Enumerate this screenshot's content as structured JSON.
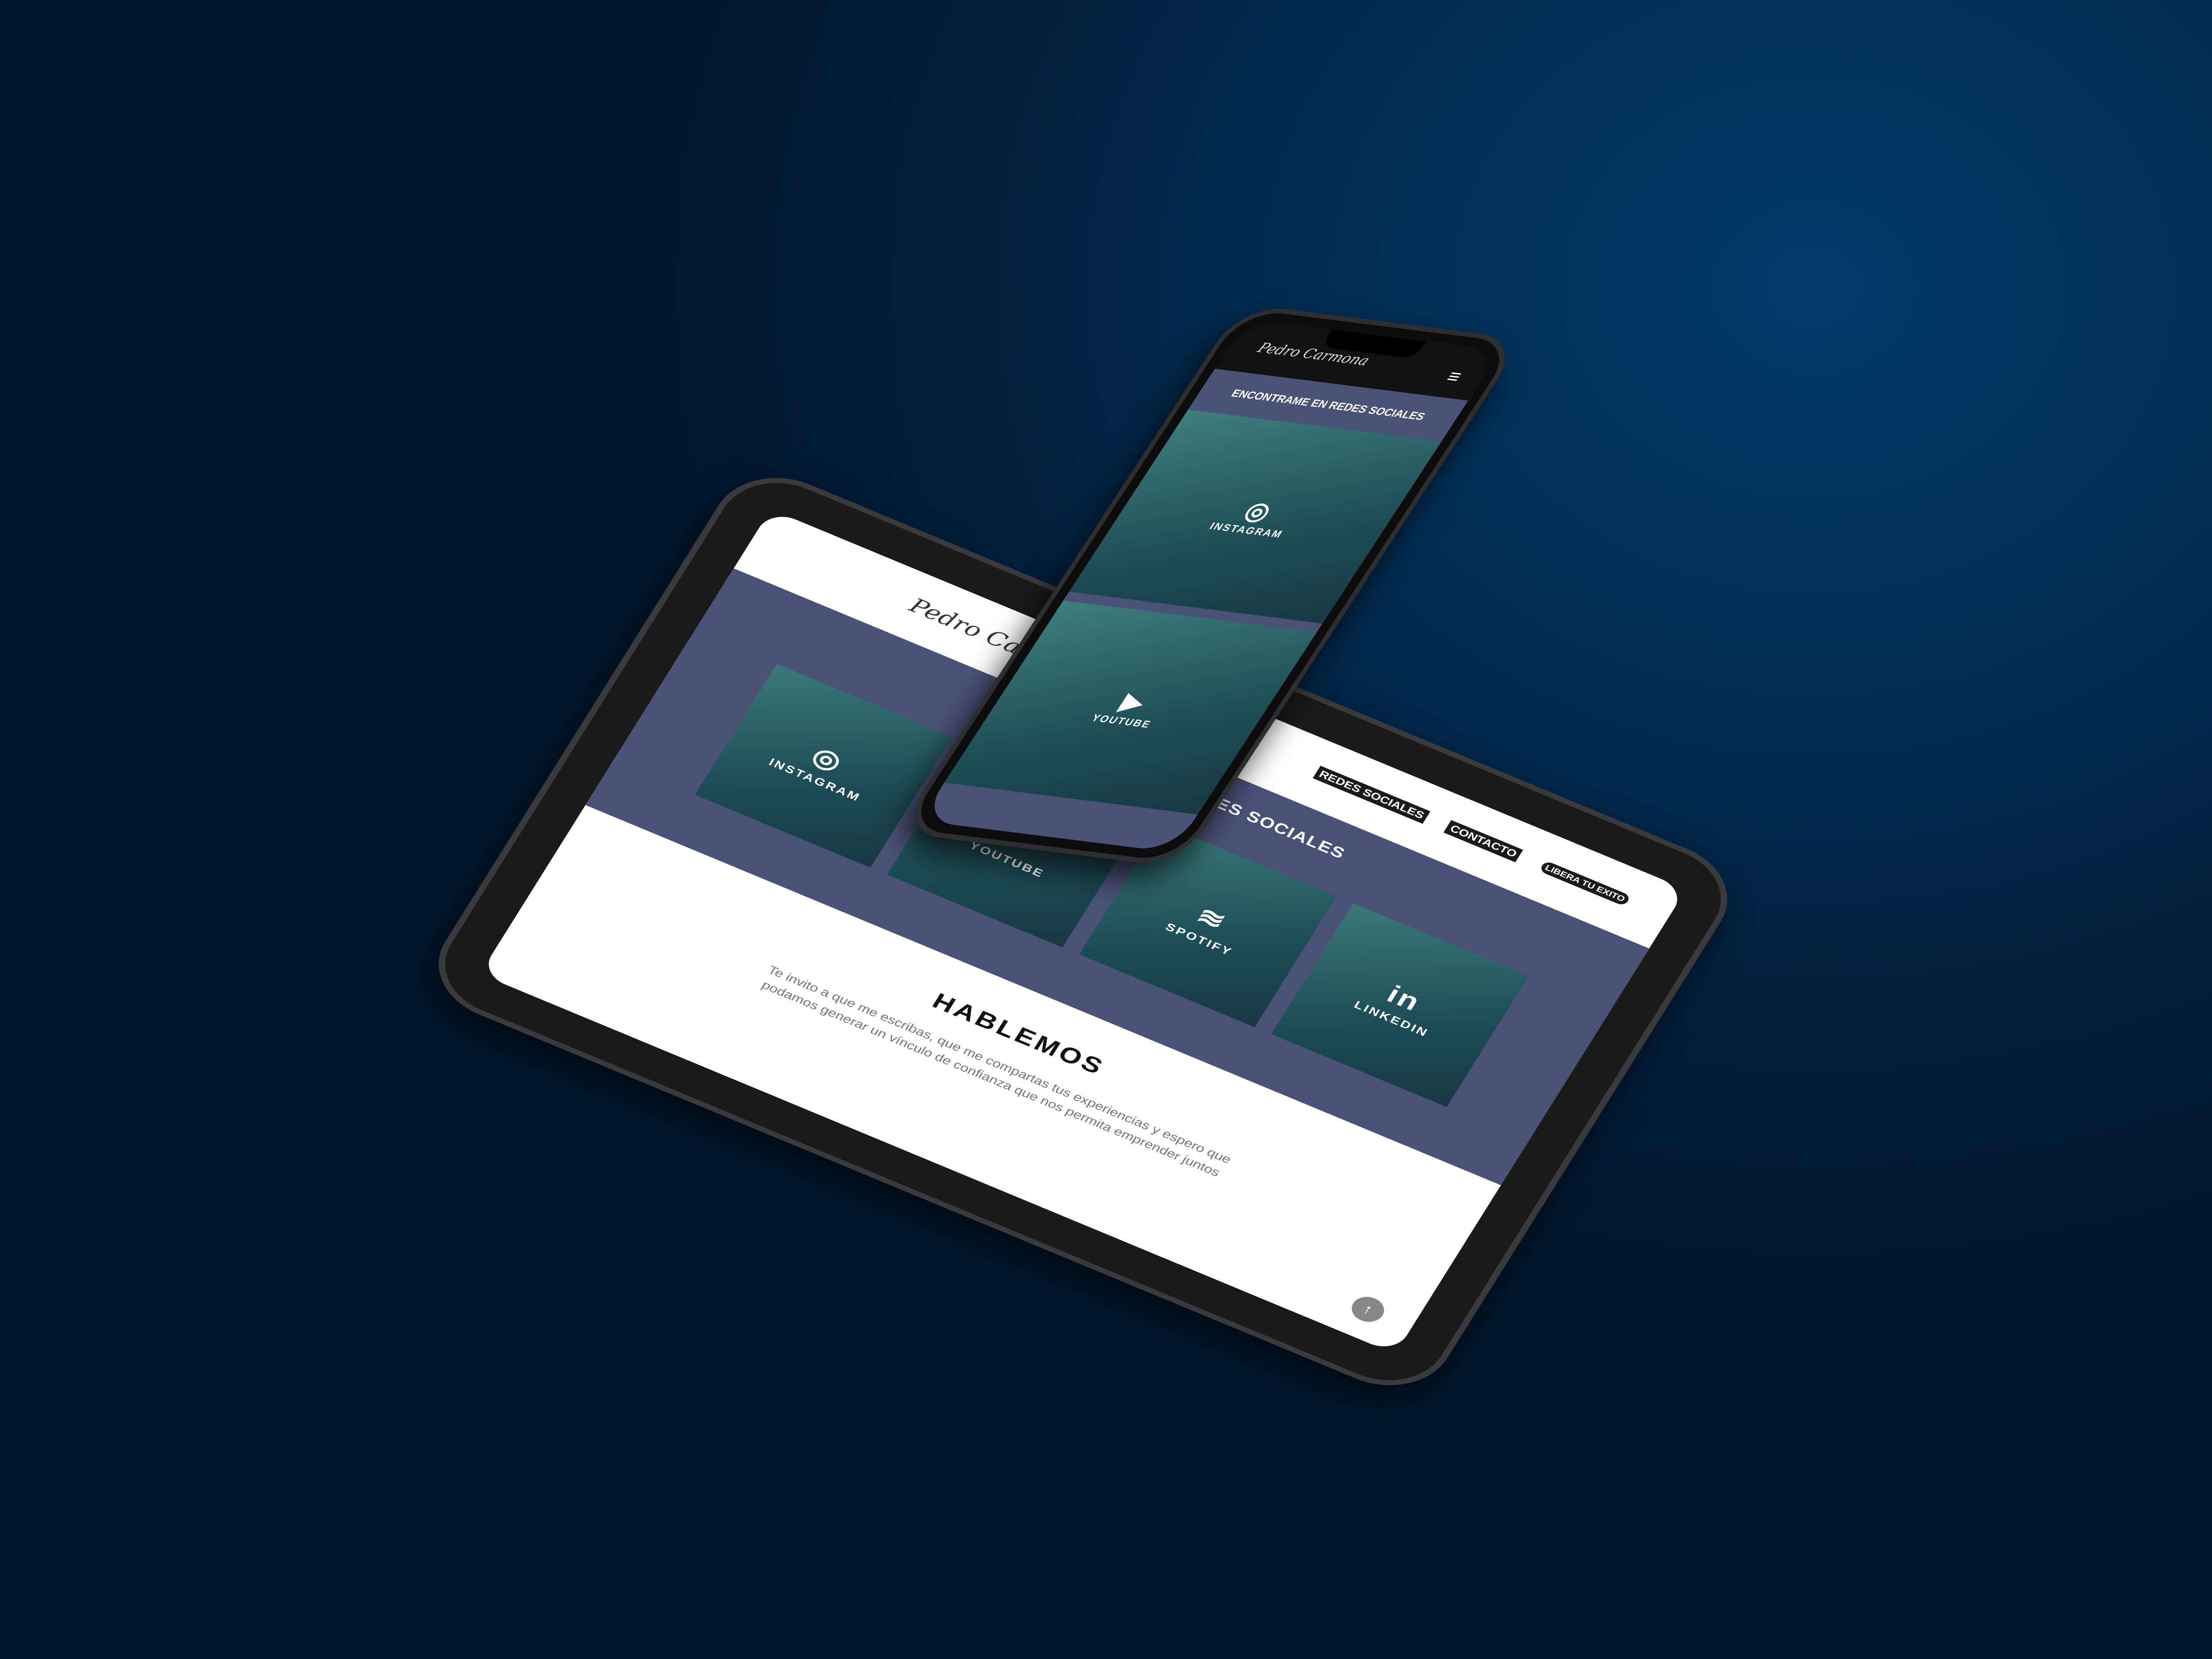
{
  "tablet": {
    "logo": "Pedro Carmona",
    "nav": [
      "REDES SOCIALES",
      "CONTACTO"
    ],
    "cta": "LIBERA TU EXITO",
    "section_title": "ENCONTRAME EN REDES SOCIALES",
    "tiles": [
      {
        "label": "INSTAGRAM",
        "icon": "◎"
      },
      {
        "label": "YOUTUBE",
        "icon": "▶"
      },
      {
        "label": "SPOTIFY",
        "icon": "≋"
      },
      {
        "label": "LINKEDIN",
        "icon": "in"
      }
    ],
    "contact_title": "HABLEMOS",
    "contact_text": "Te invito a que me escribas, que me compartas tus experiencias y espero que podamos generar un vínculo de confianza que nos permita emprender juntos",
    "scroll_up": "↑"
  },
  "phone": {
    "logo": "Pedro Carmona",
    "menu": "≡",
    "section_title": "ENCONTRAME EN REDES SOCIALES",
    "tiles": [
      {
        "label": "INSTAGRAM",
        "icon": "◎"
      },
      {
        "label": "YOUTUBE",
        "icon": "▶"
      }
    ]
  }
}
